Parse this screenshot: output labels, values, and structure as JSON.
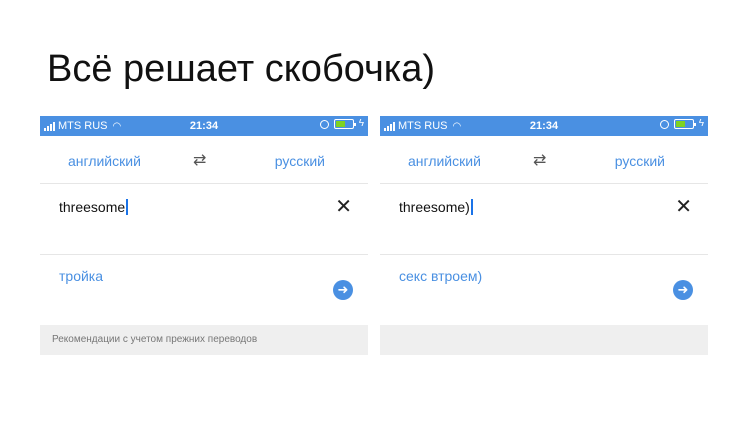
{
  "meme_title": "Всё решает скобочка)",
  "status_bar": {
    "carrier": "MTS RUS",
    "time": "21:34",
    "icons": [
      "signal-icon",
      "wifi-icon",
      "orientation-lock-icon",
      "battery-icon",
      "charging-icon"
    ]
  },
  "accent_color": "#4a90e2",
  "panels": [
    {
      "source_lang": "английский",
      "target_lang": "русский",
      "input_value": "threesome",
      "translation": "тройка",
      "recommendations": "Рекомендации с учетом прежних переводов"
    },
    {
      "source_lang": "английский",
      "target_lang": "русский",
      "input_value": "threesome)",
      "translation": "секс втроем)",
      "recommendations": ""
    }
  ]
}
